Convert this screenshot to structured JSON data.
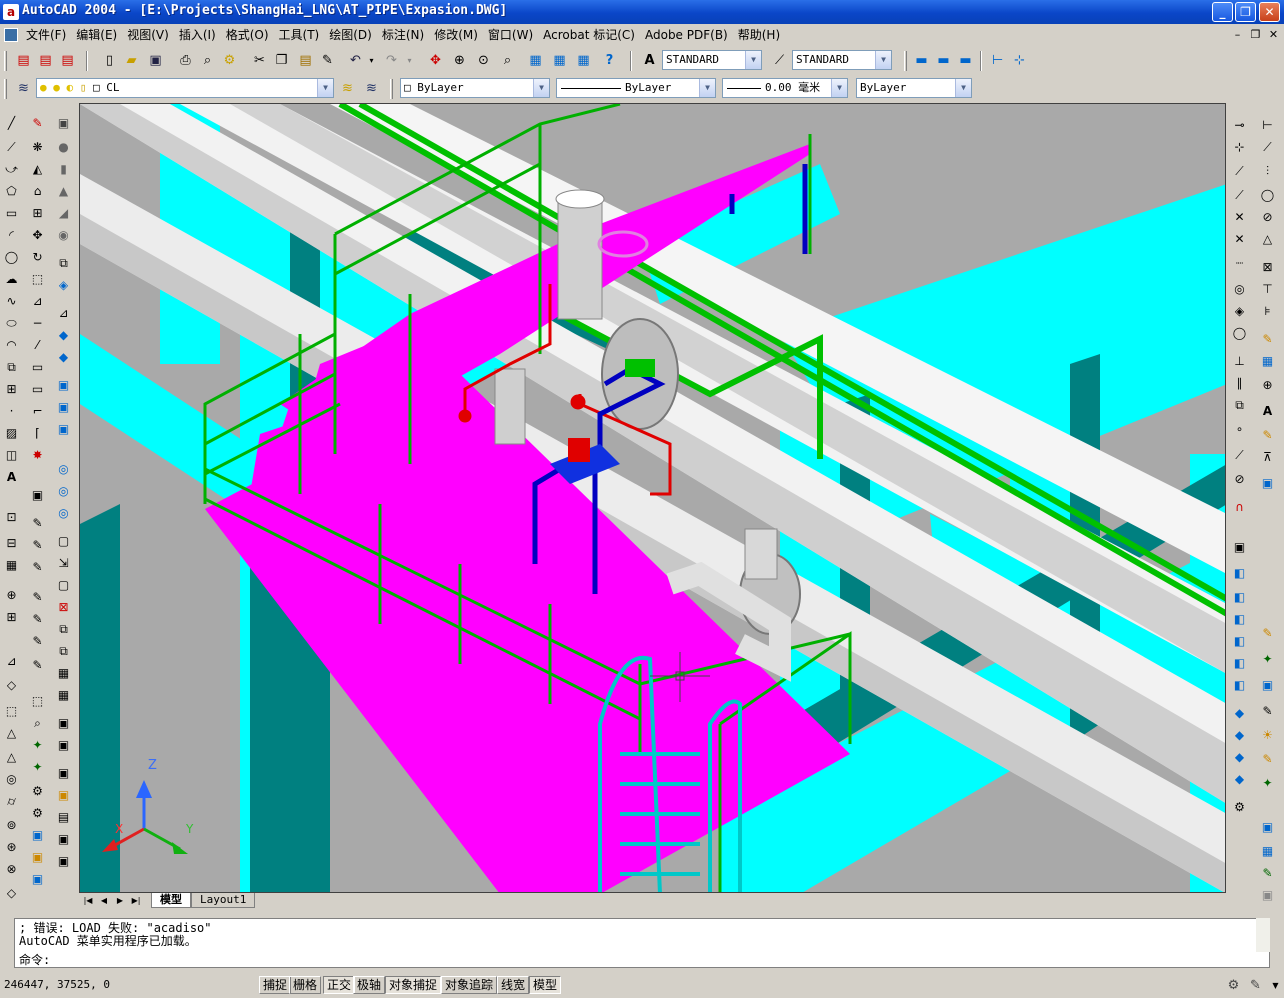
{
  "window": {
    "title": "AutoCAD 2004 - [E:\\Projects\\ShangHai_LNG\\AT_PIPE\\Expasion.DWG]",
    "app_icon_letter": "a",
    "min_glyph": "_",
    "max_glyph": "❐",
    "close_glyph": "✕"
  },
  "menus": [
    "文件(F)",
    "编辑(E)",
    "视图(V)",
    "插入(I)",
    "格式(O)",
    "工具(T)",
    "绘图(D)",
    "标注(N)",
    "修改(M)",
    "窗口(W)",
    "Acrobat 标记(C)",
    "Adobe PDF(B)",
    "帮助(H)"
  ],
  "mdi": {
    "min": "–",
    "restore": "❐",
    "close": "✕"
  },
  "styles": {
    "text_style": "STANDARD",
    "dim_style": "STANDARD"
  },
  "properties": {
    "layer": "CL",
    "color": "ByLayer",
    "linetype": "ByLayer",
    "lineweight": "0.00 毫米",
    "plotstyle": "ByLayer"
  },
  "ucs": {
    "x": "X",
    "y": "Y",
    "z": "Z"
  },
  "layout_tabs": [
    {
      "label": "模型",
      "active": true
    },
    {
      "label": "Layout1",
      "active": false
    }
  ],
  "command": {
    "line1": "; 错误: LOAD 失败: \"acadiso\"",
    "line2": "AutoCAD 菜单实用程序已加载。",
    "prompt": "命令:"
  },
  "status": {
    "coords": "246447, 37525, 0",
    "buttons": [
      {
        "label": "捕捉",
        "on": false
      },
      {
        "label": "栅格",
        "on": false
      },
      {
        "label": "正交",
        "on": true
      },
      {
        "label": "极轴",
        "on": false
      },
      {
        "label": "对象捕捉",
        "on": true
      },
      {
        "label": "对象追踪",
        "on": false
      },
      {
        "label": "线宽",
        "on": false
      },
      {
        "label": "模型",
        "on": true
      }
    ]
  },
  "colors": {
    "titlebar": "#0a46c8",
    "magenta_platform": "#ff00ff",
    "cyan_steel": "#00ffff",
    "green_rail": "#00cc00",
    "pipe_white": "#f0f0f0",
    "viewport_bg": "#a8a8a8"
  }
}
